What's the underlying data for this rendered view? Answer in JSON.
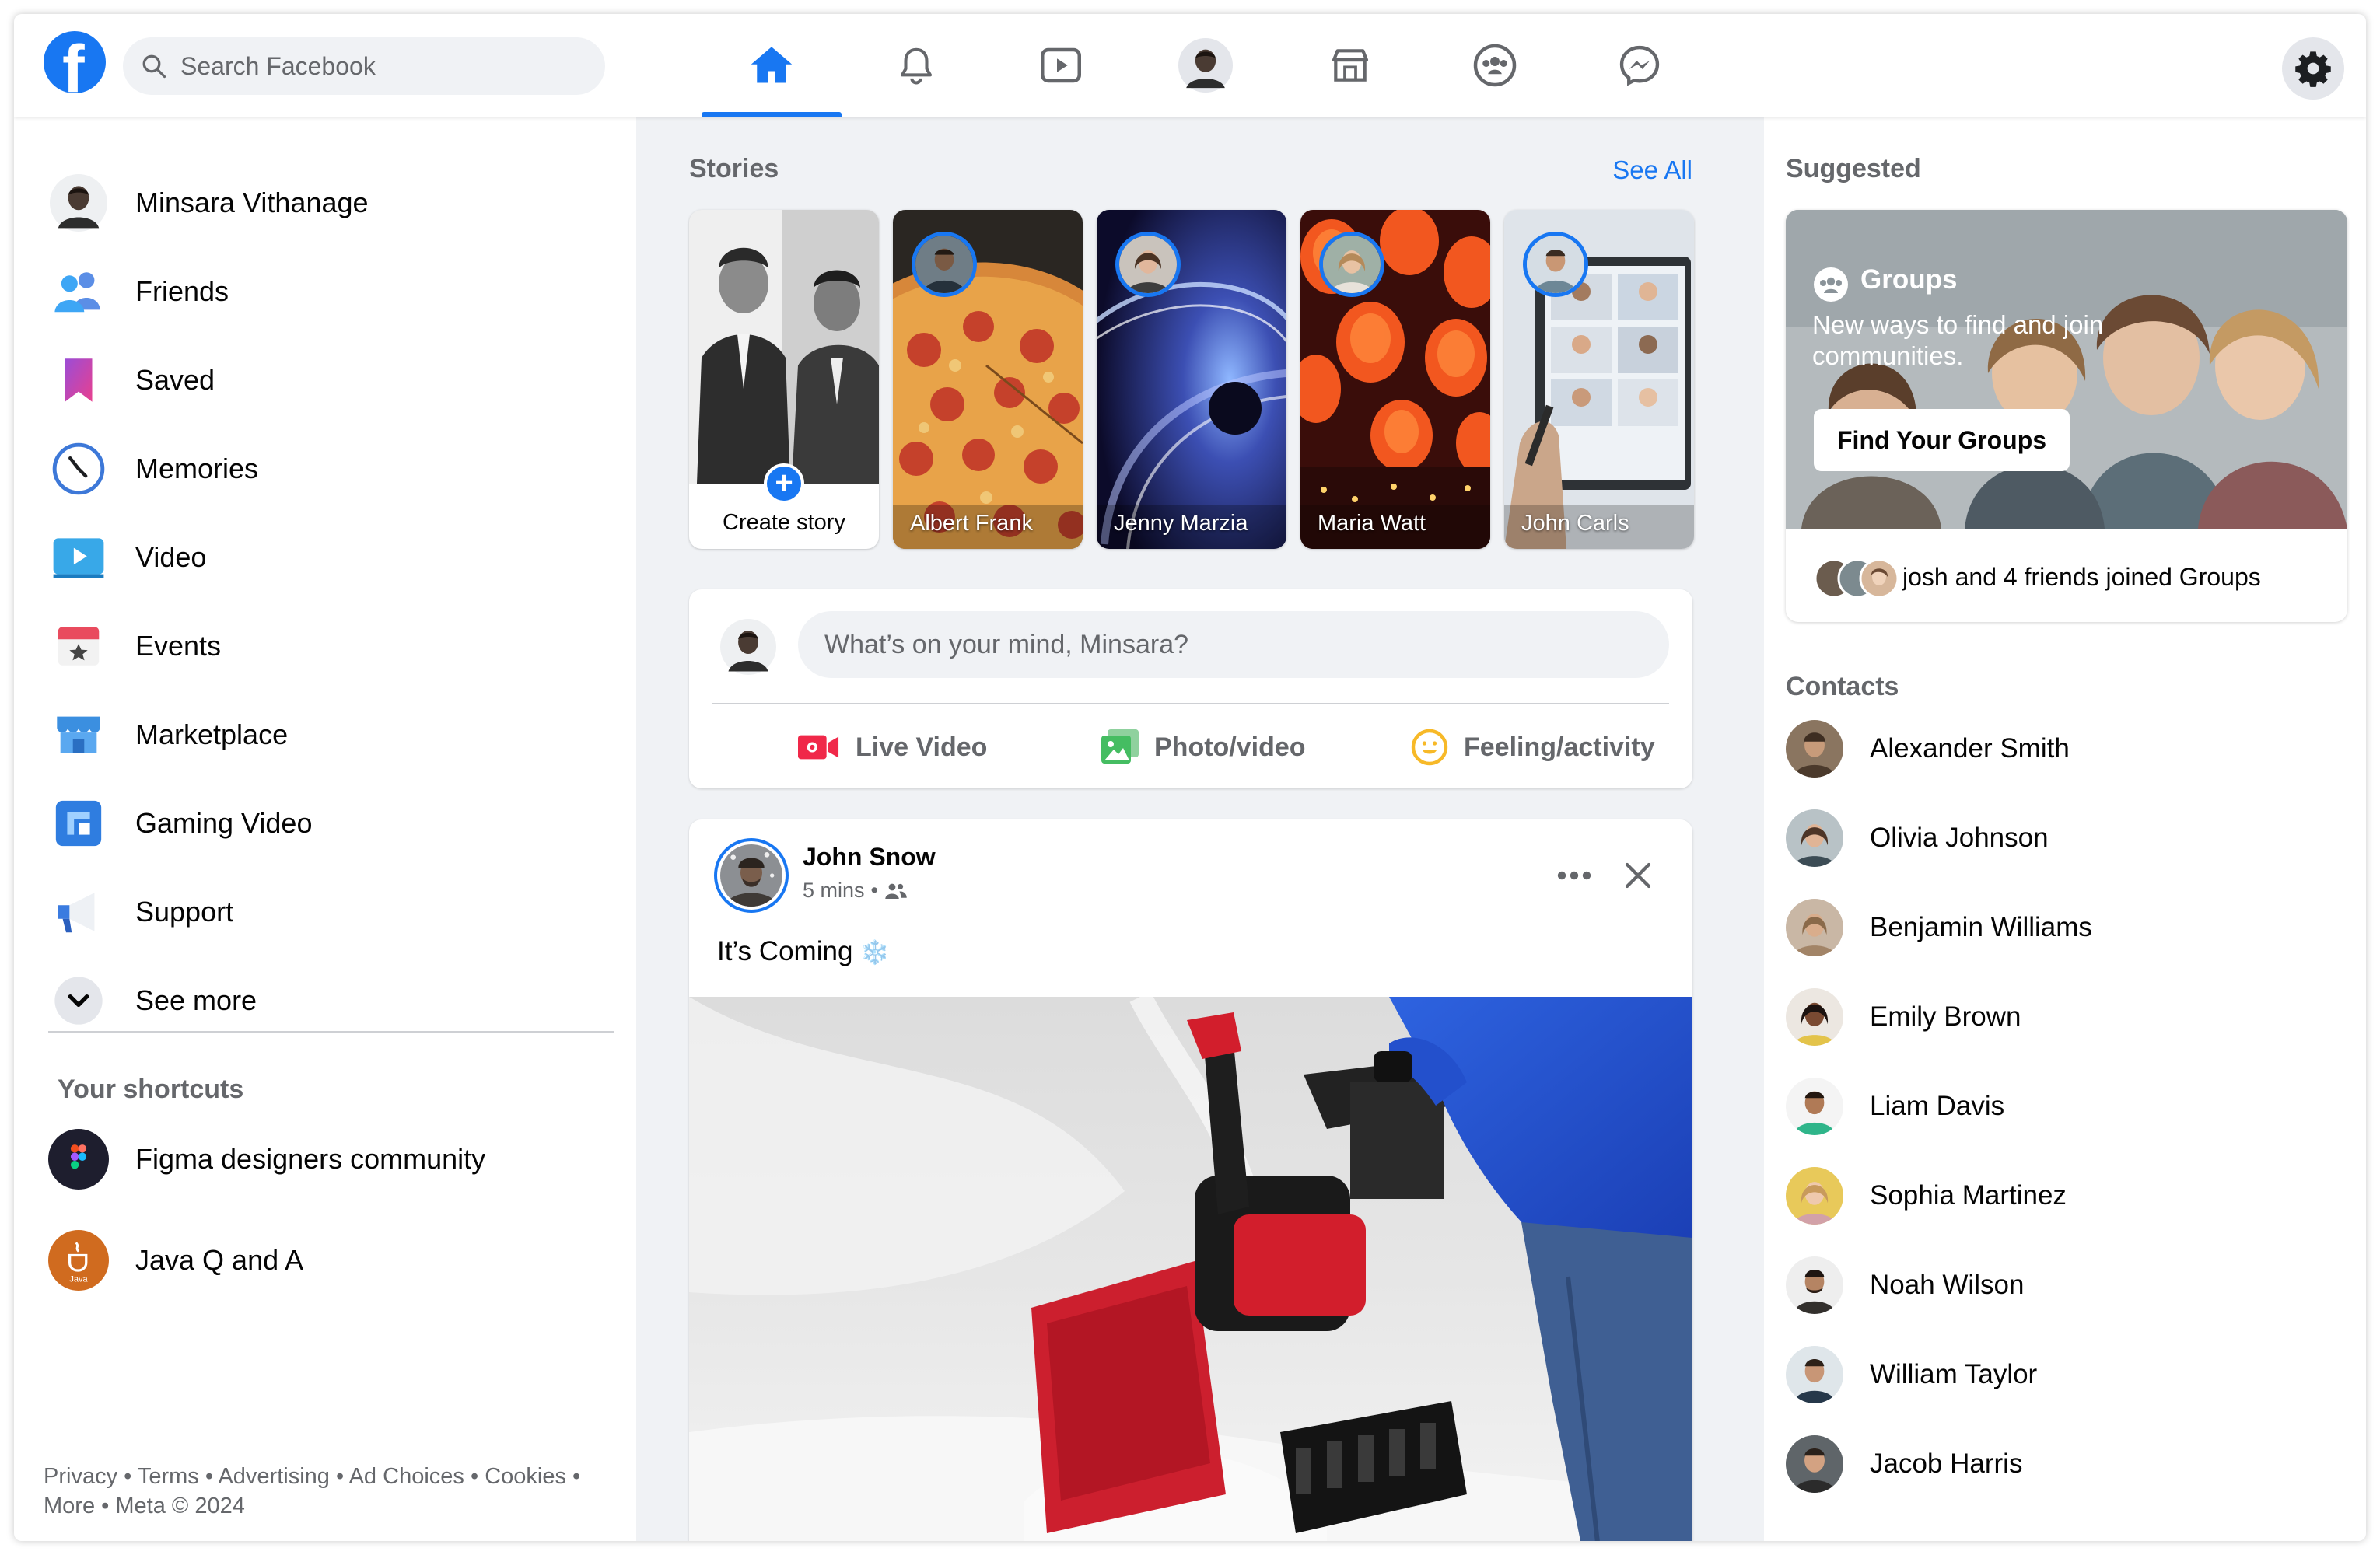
{
  "header": {
    "logo": "f",
    "search_placeholder": "Search Facebook",
    "nav_tabs": [
      "home",
      "notifications",
      "watch",
      "profile",
      "marketplace",
      "groups",
      "messenger"
    ],
    "active_tab": "home"
  },
  "sidebar": {
    "items": [
      {
        "label": "Minsara Vithanage",
        "icon": "profile-avatar"
      },
      {
        "label": "Friends",
        "icon": "friends-icon"
      },
      {
        "label": "Saved",
        "icon": "bookmark-icon"
      },
      {
        "label": "Memories",
        "icon": "clock-icon"
      },
      {
        "label": "Video",
        "icon": "video-icon"
      },
      {
        "label": "Events",
        "icon": "calendar-icon"
      },
      {
        "label": "Marketplace",
        "icon": "shop-icon"
      },
      {
        "label": "Gaming Video",
        "icon": "gaming-icon"
      },
      {
        "label": "Support",
        "icon": "megaphone-icon"
      },
      {
        "label": "See more",
        "icon": "chevron-down-icon"
      }
    ],
    "shortcuts_title": "Your shortcuts",
    "shortcuts": [
      {
        "label": "Figma designers community",
        "icon": "figma-logo"
      },
      {
        "label": "Java Q and A",
        "icon": "java-logo",
        "logo_text": "Java"
      }
    ],
    "footer": {
      "links": [
        "Privacy",
        "Terms",
        "Advertising",
        "Ad Choices",
        "Cookies",
        "More"
      ],
      "copyright": "Meta © 2024"
    }
  },
  "stories": {
    "title": "Stories",
    "see_all": "See All",
    "create_label": "Create story",
    "items": [
      {
        "name": "Albert Frank"
      },
      {
        "name": "Jenny Marzia"
      },
      {
        "name": "Maria Watt"
      },
      {
        "name": "John Carls"
      }
    ]
  },
  "composer": {
    "placeholder": "What’s on your mind, Minsara?",
    "actions": [
      {
        "label": "Live Video",
        "icon": "live-video-icon",
        "color": "#f02849"
      },
      {
        "label": "Photo/video",
        "icon": "photo-icon",
        "color": "#45bd62"
      },
      {
        "label": "Feeling/activity",
        "icon": "feeling-icon",
        "color": "#f7b928"
      }
    ]
  },
  "post": {
    "author": "John Snow",
    "time": "5 mins",
    "privacy_icon": "friends-icon",
    "text": "It’s Coming",
    "emoji": "❄️"
  },
  "right": {
    "suggested_title": "Suggested",
    "groups_card": {
      "label": "Groups",
      "description": "New ways to find and join communities.",
      "button": "Find Your Groups",
      "footer": "josh and 4 friends joined Groups"
    },
    "contacts_title": "Contacts",
    "contacts": [
      {
        "name": "Alexander Smith"
      },
      {
        "name": "Olivia Johnson"
      },
      {
        "name": "Benjamin Williams"
      },
      {
        "name": "Emily Brown"
      },
      {
        "name": "Liam Davis"
      },
      {
        "name": "Sophia Martinez"
      },
      {
        "name": "Noah Wilson"
      },
      {
        "name": "William Taylor"
      },
      {
        "name": "Jacob Harris"
      }
    ]
  },
  "colors": {
    "brand": "#1877f2",
    "background": "#f0f2f5",
    "secondary_text": "#65676b"
  }
}
